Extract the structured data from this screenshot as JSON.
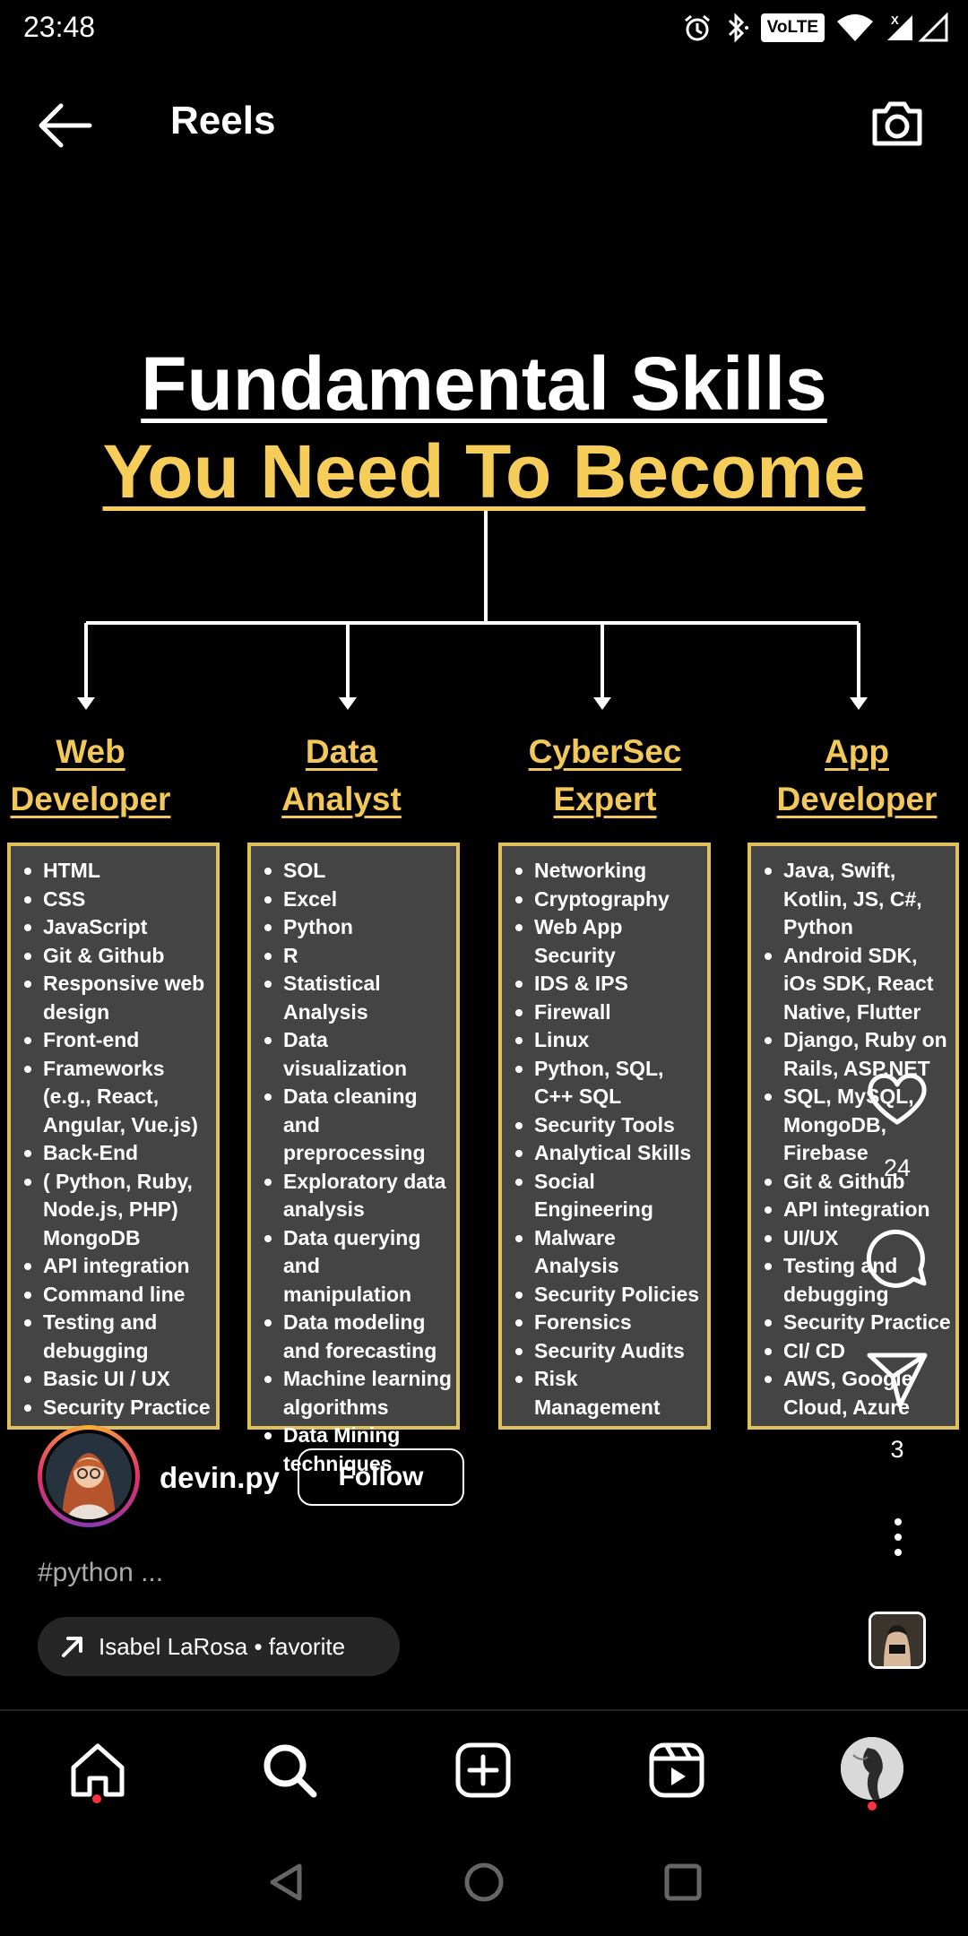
{
  "status_bar": {
    "time": "23:48",
    "volte": "VoLTE",
    "icons": [
      "alarm-icon",
      "bluetooth-icon",
      "wifi-icon",
      "signal-icon"
    ]
  },
  "header": {
    "title": "Reels",
    "back_icon": "arrow-left-icon",
    "camera_icon": "camera-icon"
  },
  "reel": {
    "title_line1": "Fundamental Skills",
    "title_line2": "You Need To Become",
    "accent_color": "#f7cd5a",
    "columns": [
      {
        "title": [
          "Web",
          "Developer"
        ],
        "items": [
          "HTML",
          "CSS",
          "JavaScript",
          "Git & Github",
          "Responsive web design",
          "Front-end",
          "Frameworks (e.g., React, Angular, Vue.js)",
          "Back-End",
          "( Python, Ruby, Node.js, PHP) MongoDB",
          "API integration",
          "Command line",
          "Testing and debugging",
          "Basic UI / UX",
          "Security Practice"
        ]
      },
      {
        "title": [
          "Data",
          "Analyst"
        ],
        "items": [
          "SOL",
          "Excel",
          "Python",
          "R",
          "Statistical Analysis",
          "Data visualization",
          "Data cleaning and preprocessing",
          "Exploratory data analysis",
          "Data querying and manipulation",
          "Data modeling and forecasting",
          "Machine learning algorithms",
          "Data Mining techniques"
        ]
      },
      {
        "title": [
          "CyberSec",
          "Expert"
        ],
        "items": [
          "Networking",
          "Cryptography",
          "Web App Security",
          "IDS & IPS",
          "Firewall",
          "Linux",
          "Python, SQL, C++ SQL",
          "Security Tools",
          "Analytical Skills",
          "Social Engineering",
          "Malware Analysis",
          "Security Policies",
          "Forensics",
          "Security Audits",
          "Risk Management"
        ]
      },
      {
        "title": [
          "App",
          "Developer"
        ],
        "items": [
          "Java, Swift, Kotlin, JS, C#, Python",
          "Android SDK, iOs SDK, React Native, Flutter",
          "Django, Ruby on Rails, ASP.NET",
          "SQL, MySQL, MongoDB, Firebase",
          "Git & Github",
          "API integration",
          "UI/UX",
          "Testing and debugging",
          "Security Practice",
          "CI/ CD",
          "AWS, Google Cloud, Azure"
        ]
      }
    ]
  },
  "actions": {
    "likes": "24",
    "shares": "3"
  },
  "author": {
    "username": "devin.py",
    "follow_label": "Follow"
  },
  "caption": "#python ...",
  "audio": {
    "text": "Isabel LaRosa • favorite"
  },
  "nav": {
    "items": [
      "home-icon",
      "search-icon",
      "create-icon",
      "reels-icon",
      "profile-avatar"
    ]
  }
}
